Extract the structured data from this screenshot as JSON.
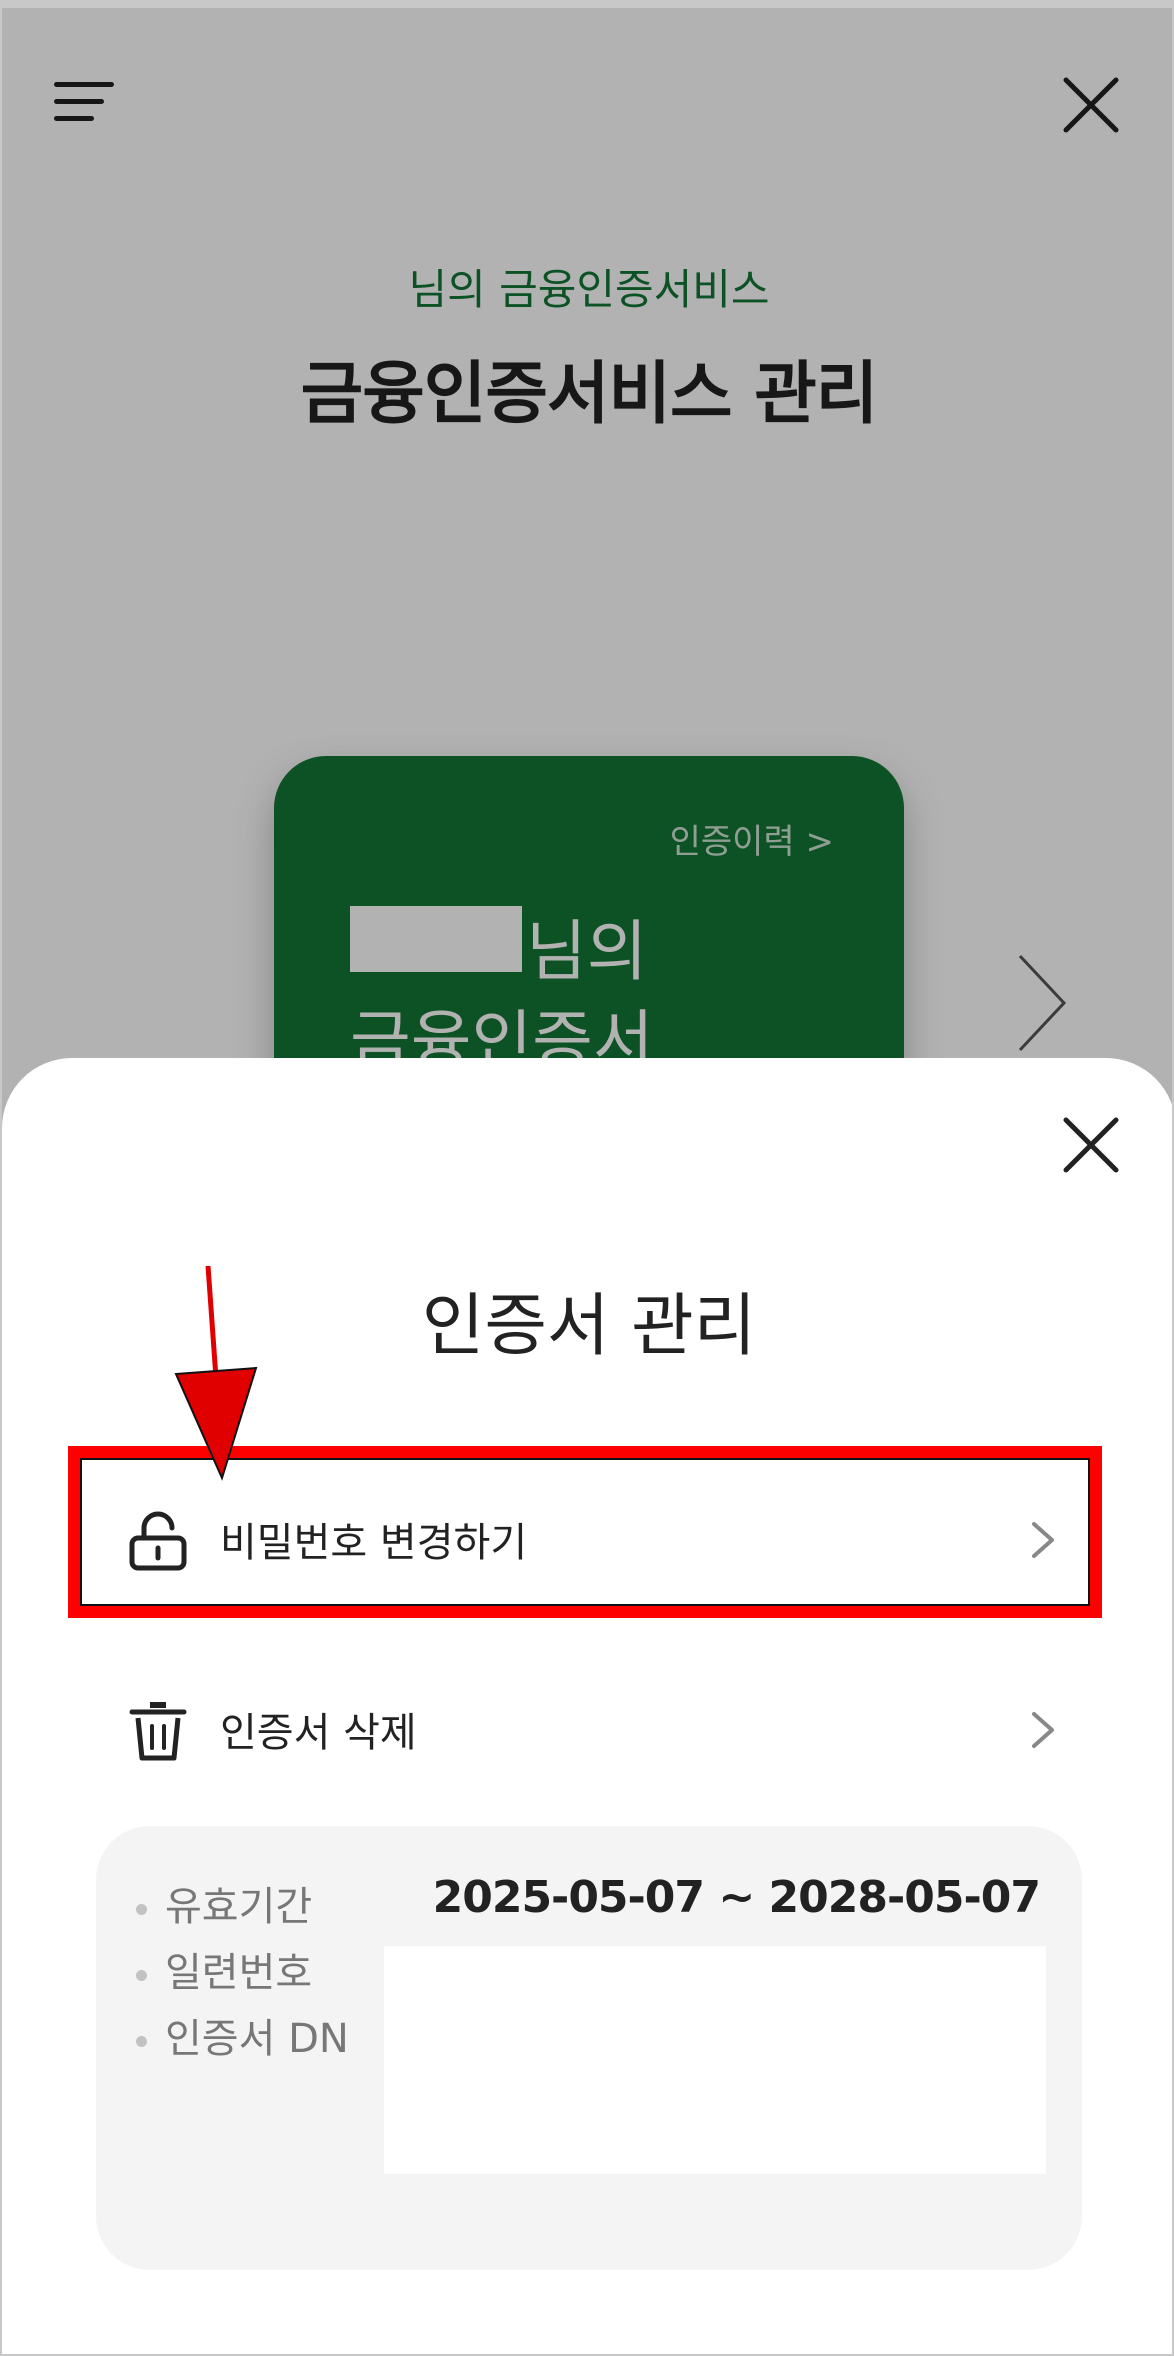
{
  "header": {
    "subtitle": "님의 금융인증서비스",
    "title": "금융인증서비스 관리"
  },
  "card": {
    "history_link": "인증이력 >",
    "name_suffix": "님의",
    "label": "금융인증서",
    "color": "#127634"
  },
  "sheet": {
    "title": "인증서 관리",
    "items": [
      {
        "label": "비밀번호 변경하기",
        "icon": "unlock-icon"
      },
      {
        "label": "인증서 삭제",
        "icon": "trash-icon"
      }
    ],
    "info": {
      "validity_label": "유효기간",
      "validity_value": "2025-05-07 ~ 2028-05-07",
      "serial_label": "일련번호",
      "dn_label": "인증서 DN"
    }
  },
  "annotation": {
    "highlight_color": "#ff0000"
  },
  "icons": [
    "menu-icon",
    "close-icon",
    "chevron-right-icon",
    "unlock-icon",
    "trash-icon",
    "arrow-down-icon"
  ]
}
